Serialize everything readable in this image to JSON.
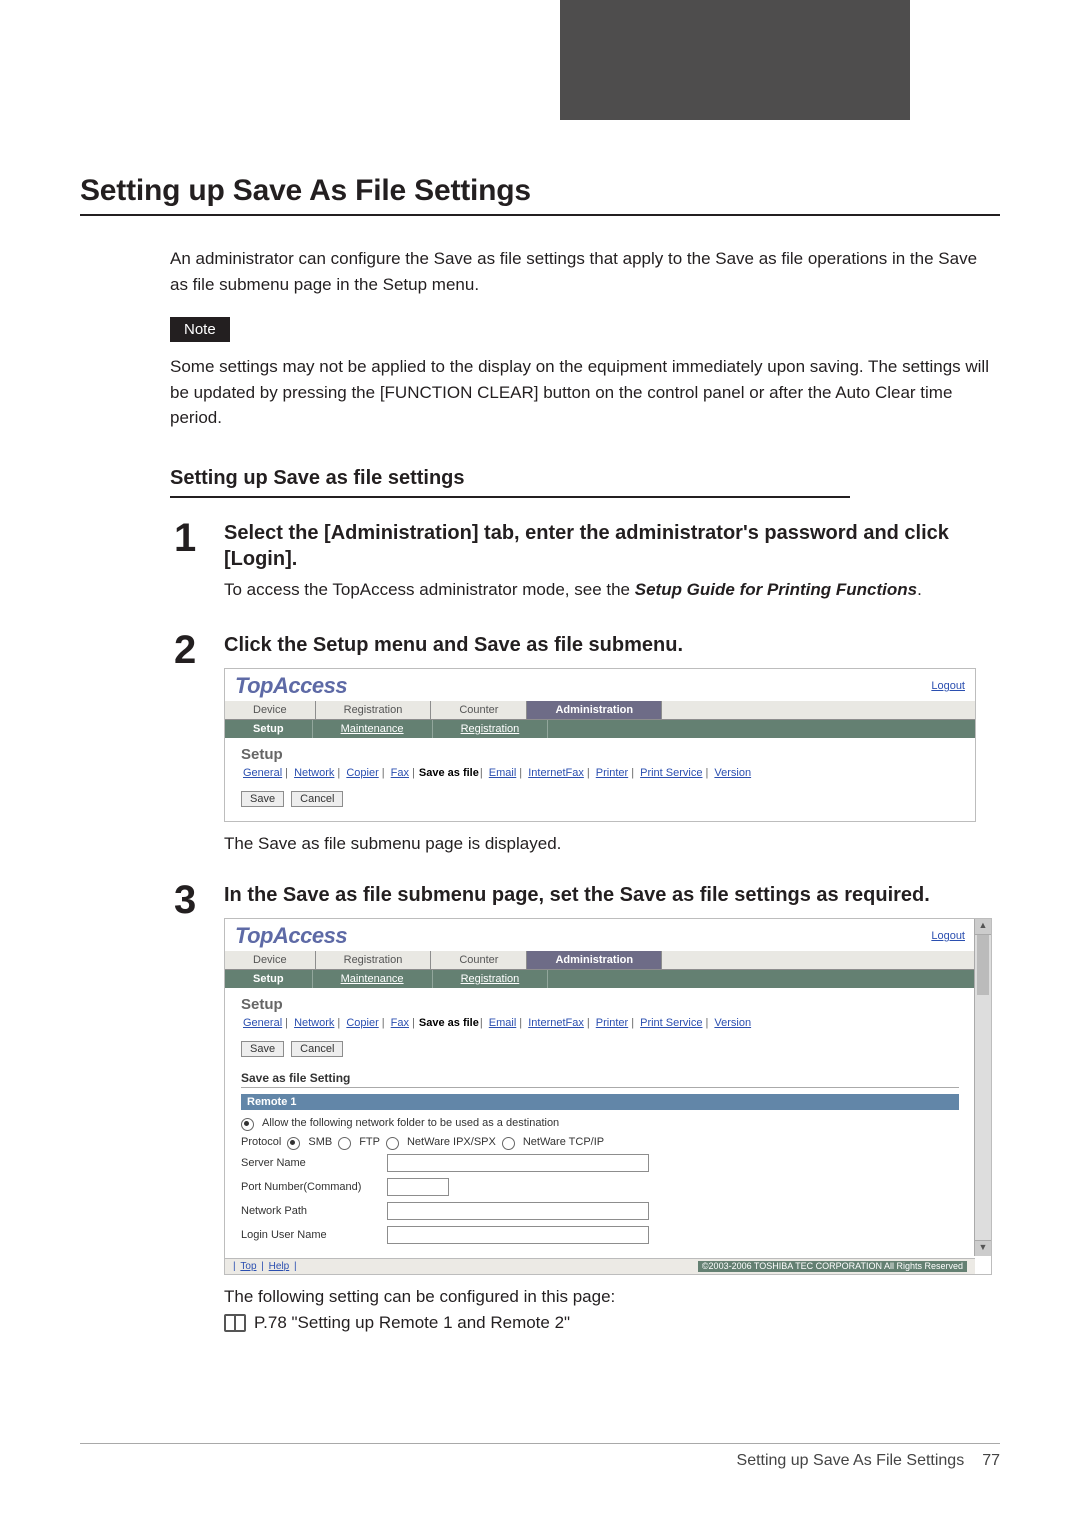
{
  "header": {
    "title": "Setting up Save As File Settings"
  },
  "intro": "An administrator can configure the Save as file settings that apply to the Save as file operations in the Save as file submenu page in the Setup menu.",
  "note": {
    "label": "Note",
    "text": "Some settings may not be applied to the display on the equipment immediately upon saving. The settings will be updated by pressing the [FUNCTION CLEAR] button on the control panel or after the Auto Clear time period."
  },
  "subhead": "Setting up Save as file settings",
  "steps": [
    {
      "num": "1",
      "title": "Select the [Administration] tab, enter the administrator's password and click [Login].",
      "text_pre": "To access the TopAccess administrator mode, see the ",
      "text_em": "Setup Guide for Printing Functions",
      "text_post": "."
    },
    {
      "num": "2",
      "title": "Click the Setup menu and Save as file submenu.",
      "caption": "The Save as file submenu page is displayed."
    },
    {
      "num": "3",
      "title": "In the Save as file submenu page, set the Save as file settings as required.",
      "caption": "The following setting can be configured in this page:",
      "xref": "P.78 \"Setting up Remote 1 and Remote 2\""
    }
  ],
  "topaccess": {
    "logo": "TopAccess",
    "logout": "Logout",
    "tabs": [
      "Device",
      "Registration",
      "Counter",
      "Administration"
    ],
    "active_tab": "Administration",
    "subtabs": [
      "Setup",
      "Maintenance",
      "Registration"
    ],
    "active_subtab": "Setup",
    "setup_label": "Setup",
    "crumbs": [
      "General",
      "Network",
      "Copier",
      "Fax",
      "Save as file",
      "Email",
      "InternetFax",
      "Printer",
      "Print Service",
      "Version"
    ],
    "current_crumb": "Save as file",
    "buttons": {
      "save": "Save",
      "cancel": "Cancel"
    },
    "setting_section": "Save as file Setting",
    "remote_bar": "Remote 1",
    "allow_text": "Allow the following network folder to be used as a destination",
    "protocol_label": "Protocol",
    "protocols": [
      "SMB",
      "FTP",
      "NetWare IPX/SPX",
      "NetWare TCP/IP"
    ],
    "protocol_selected": "SMB",
    "rows": {
      "server": "Server Name",
      "port": "Port Number(Command)",
      "path": "Network Path",
      "user": "Login User Name"
    },
    "footer_links": [
      "Top",
      "Help"
    ],
    "copyright": "©2003-2006 TOSHIBA TEC CORPORATION All Rights Reserved"
  },
  "footer": {
    "text": "Setting up Save As File Settings",
    "page": "77"
  }
}
